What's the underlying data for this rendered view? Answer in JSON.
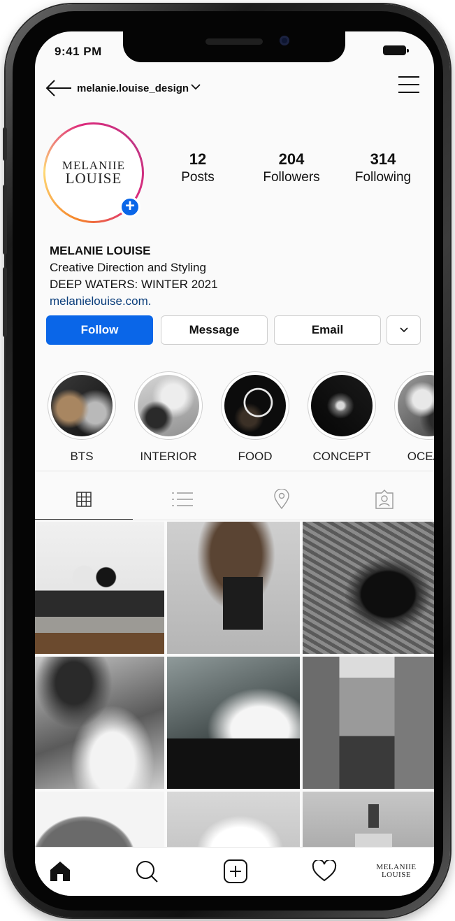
{
  "status_bar": {
    "time": "9:41 PM"
  },
  "header": {
    "username": "melanie.louise_design"
  },
  "profile": {
    "avatar_line1": "MELANIIE",
    "avatar_line2": "LOUISE",
    "stats": [
      {
        "value": "12",
        "label": "Posts"
      },
      {
        "value": "204",
        "label": "Followers"
      },
      {
        "value": "314",
        "label": "Following"
      }
    ]
  },
  "bio": {
    "name": "MELANIE LOUISE",
    "line1": "Creative Direction and Styling",
    "line2": "DEEP WATERS: WINTER 2021",
    "link": "melanielouise.com."
  },
  "actions": {
    "follow": "Follow",
    "message": "Message",
    "email": "Email"
  },
  "highlights": [
    {
      "label": "BTS"
    },
    {
      "label": "INTERIOR"
    },
    {
      "label": "FOOD"
    },
    {
      "label": "CONCEPT"
    },
    {
      "label": "OCEAN"
    }
  ],
  "tabs": [
    "grid-icon",
    "list-icon",
    "location-pin-icon",
    "tagged-icon"
  ],
  "grid_photos": [
    "bedroom",
    "dried-flowers-vase",
    "black-cup-knit",
    "ocean-waves-1",
    "ocean-waves-2",
    "coastal-cliffs",
    "ceramic-vase",
    "white-coral",
    "soap-dispenser"
  ],
  "bottom_nav": {
    "items": [
      "home-icon",
      "search-icon",
      "new-post-icon",
      "heart-icon",
      "profile-avatar"
    ],
    "avatar_line1": "MELANIIE",
    "avatar_line2": "LOUISE"
  },
  "colors": {
    "accent": "#0a66e8",
    "link": "#0a3d7a",
    "background": "#fafafa"
  }
}
